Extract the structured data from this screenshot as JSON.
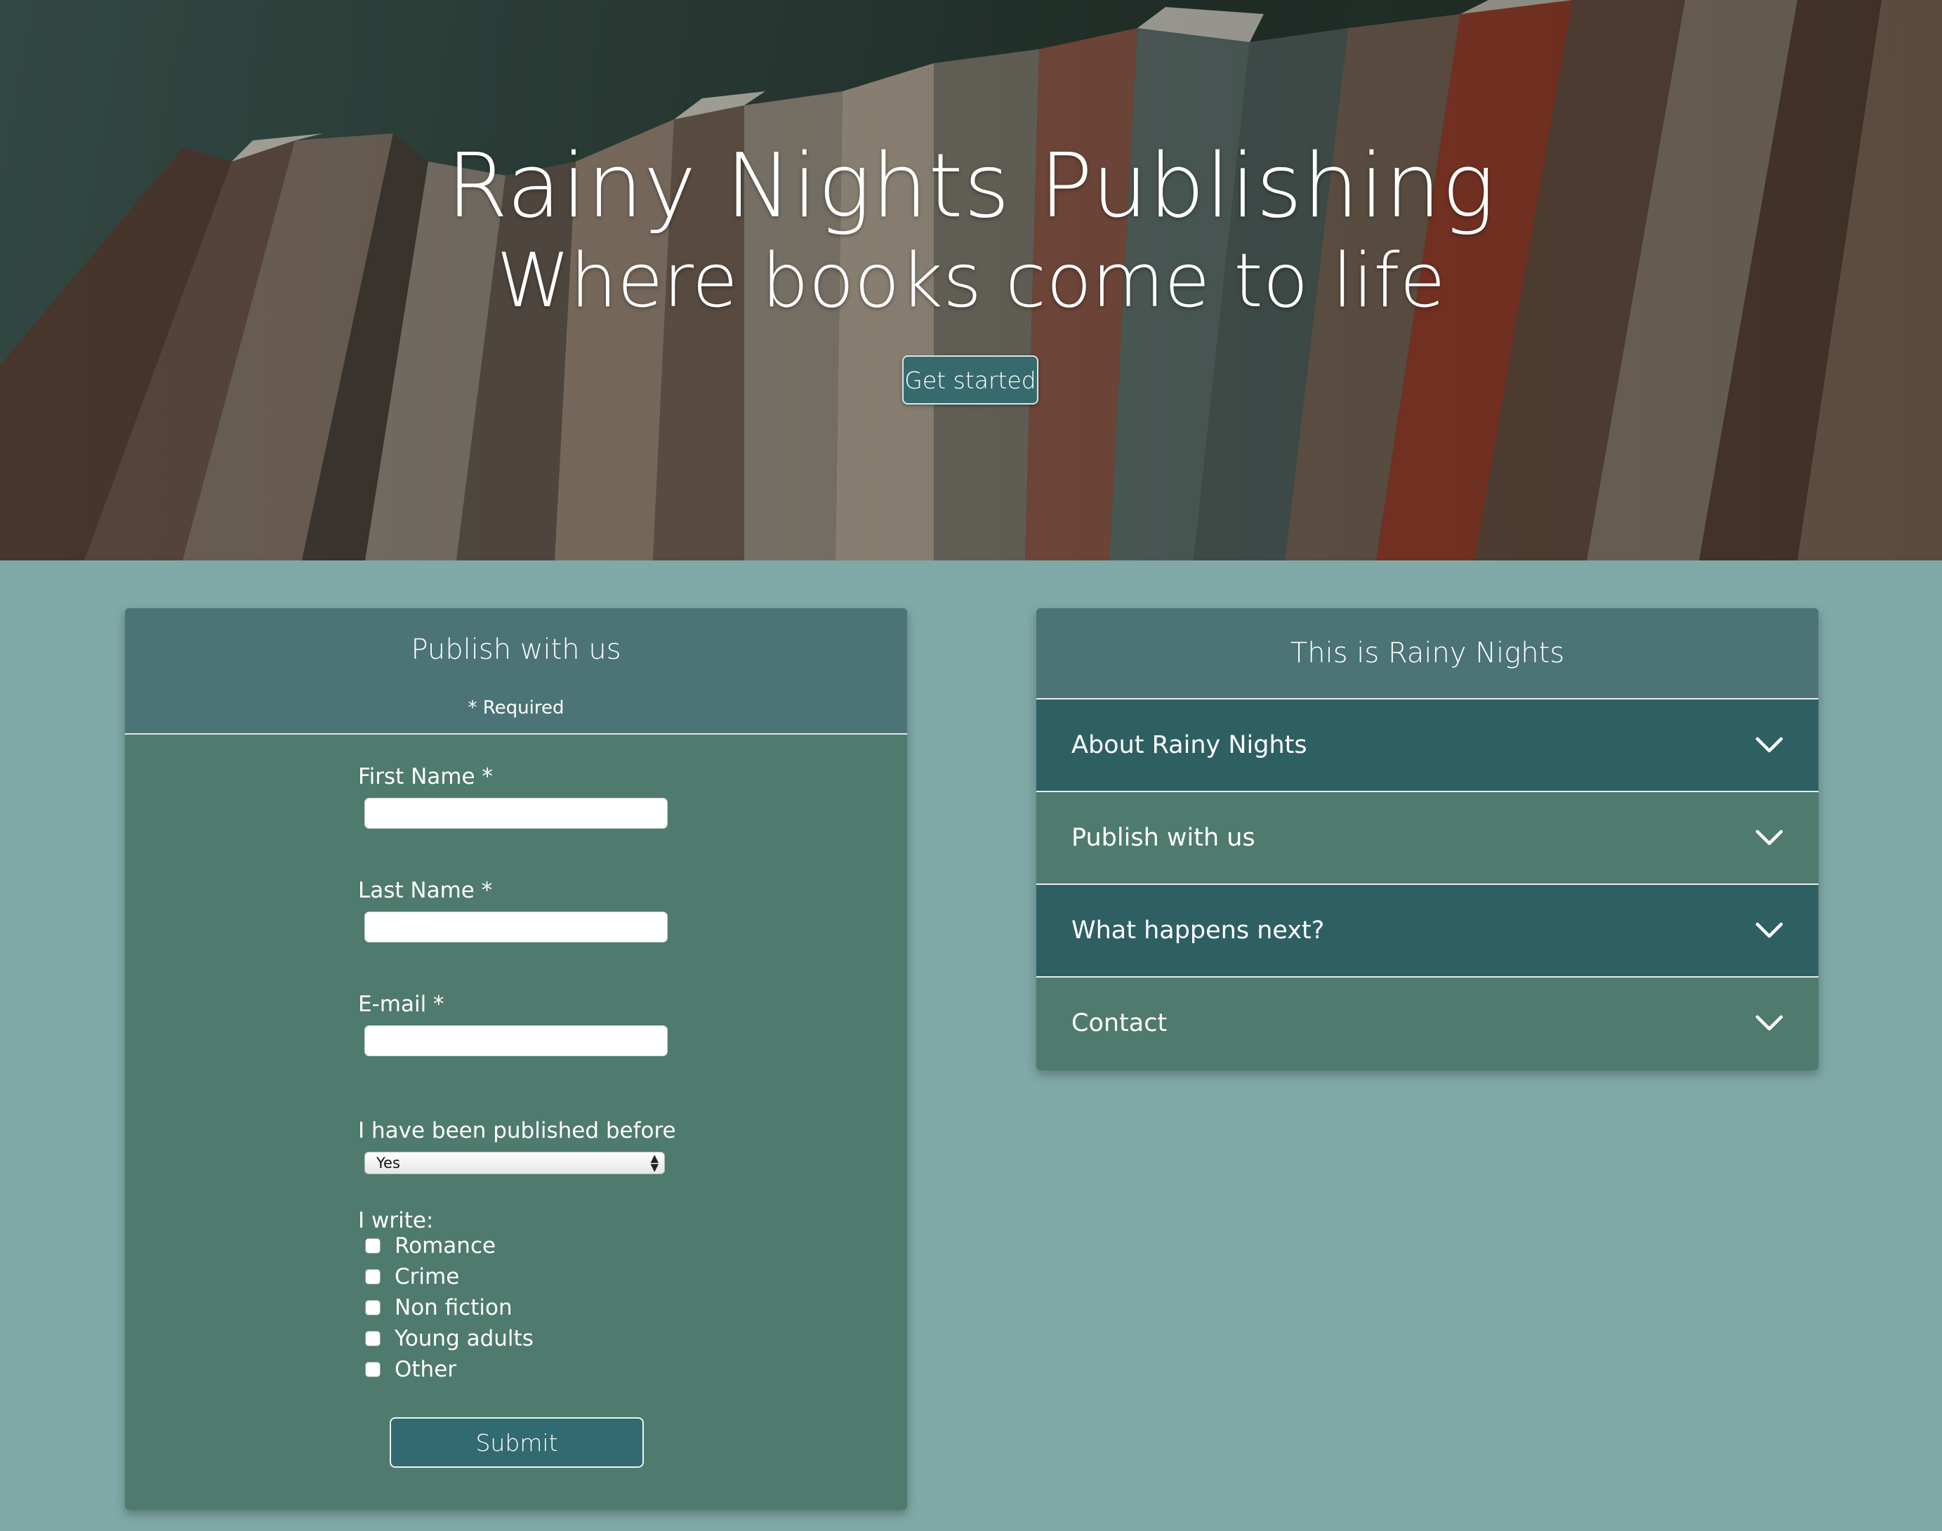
{
  "hero": {
    "title": "Rainy Nights Publishing",
    "subtitle": "Where books come to life",
    "cta_label": "Get started"
  },
  "form": {
    "title": "Publish with us",
    "required_note": "* Required",
    "fields": [
      {
        "label": "First Name *",
        "value": ""
      },
      {
        "label": "Last Name *",
        "value": ""
      },
      {
        "label": "E-mail *",
        "value": ""
      }
    ],
    "published_label": "I have been published before",
    "published_value": "Yes",
    "write_label": "I write:",
    "genres": [
      "Romance",
      "Crime",
      "Non fiction",
      "Young adults",
      "Other"
    ],
    "submit_label": "Submit"
  },
  "accordion": {
    "title": "This is Rainy Nights",
    "items": [
      {
        "label": "About Rainy Nights"
      },
      {
        "label": "Publish with us"
      },
      {
        "label": "What happens next?"
      },
      {
        "label": "Contact"
      }
    ]
  },
  "colors": {
    "page_bg": "#7fa8a7",
    "card_bg": "#4f7a6e",
    "card_header": "#4c7375",
    "accordion_dark": "#2e5f63",
    "button_bg": "#316a70"
  }
}
